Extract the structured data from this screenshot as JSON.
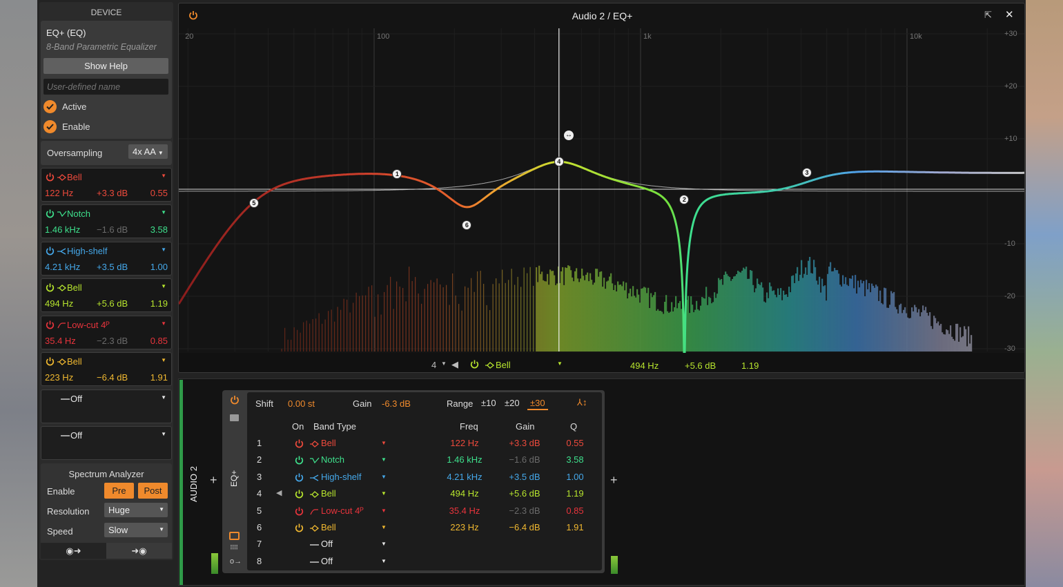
{
  "window": {
    "title": "Audio 2 / EQ+"
  },
  "device_panel": {
    "header": "DEVICE",
    "name": "EQ+ (EQ)",
    "description": "8-Band Parametric Equalizer",
    "show_help": "Show Help",
    "user_name_placeholder": "User-defined name",
    "active_label": "Active",
    "active": true,
    "enable_label": "Enable",
    "enable": true,
    "oversampling_label": "Oversampling",
    "oversampling_value": "4x AA",
    "off_label": "Off",
    "spectrum": {
      "title": "Spectrum Analyzer",
      "enable_label": "Enable",
      "pre": "Pre",
      "post": "Post",
      "resolution_label": "Resolution",
      "resolution": "Huge",
      "speed_label": "Speed",
      "speed": "Slow"
    }
  },
  "bands": [
    {
      "num": "1",
      "type": "Bell",
      "icon": "bell",
      "freq": "122 Hz",
      "gain": "+3.3 dB",
      "q": "0.55",
      "freq_hz": 122,
      "gain_db": 3.3,
      "q_val": 0.55,
      "color": "#ee4a3c",
      "gain_dim": false
    },
    {
      "num": "2",
      "type": "Notch",
      "icon": "notch",
      "freq": "1.46 kHz",
      "gain": "−1.6 dB",
      "q": "3.58",
      "freq_hz": 1460,
      "gain_db": -1.6,
      "q_val": 3.58,
      "color": "#3ee08c",
      "gain_dim": true
    },
    {
      "num": "3",
      "type": "High-shelf",
      "icon": "high-shelf",
      "freq": "4.21 kHz",
      "gain": "+3.5 dB",
      "q": "1.00",
      "freq_hz": 4210,
      "gain_db": 3.5,
      "q_val": 1.0,
      "color": "#45a8ea",
      "gain_dim": false
    },
    {
      "num": "4",
      "type": "Bell",
      "icon": "bell",
      "freq": "494 Hz",
      "gain": "+5.6 dB",
      "q": "1.19",
      "freq_hz": 494,
      "gain_db": 5.6,
      "q_val": 1.19,
      "color": "#b8e62e",
      "gain_dim": false
    },
    {
      "num": "5",
      "type": "Low-cut 4ᴾ",
      "icon": "low-cut",
      "freq": "35.4 Hz",
      "gain": "−2.3 dB",
      "q": "0.85",
      "freq_hz": 35.4,
      "gain_db": -2.3,
      "q_val": 0.85,
      "color": "#e8343c",
      "gain_dim": true
    },
    {
      "num": "6",
      "type": "Bell",
      "icon": "bell",
      "freq": "223 Hz",
      "gain": "−6.4 dB",
      "q": "1.91",
      "freq_hz": 223,
      "gain_db": -6.4,
      "q_val": 1.91,
      "color": "#f0b830",
      "gain_dim": false
    },
    {
      "num": "7",
      "type": "Off",
      "icon": "off",
      "color": "#e8e8e8"
    },
    {
      "num": "8",
      "type": "Off",
      "icon": "off",
      "color": "#e8e8e8"
    }
  ],
  "graph": {
    "freq_ticks": [
      "20",
      "100",
      "1k",
      "10k"
    ],
    "freq_tick_values": [
      20,
      100,
      1000,
      10000
    ],
    "db_ticks": [
      "+30",
      "+20",
      "+10",
      "-10",
      "-20",
      "-30"
    ],
    "db_tick_values": [
      30,
      20,
      10,
      -10,
      -20,
      -30
    ],
    "selected_band": "4",
    "selected": {
      "num": "4",
      "type": "Bell",
      "freq": "494 Hz",
      "gain": "+5.6 dB",
      "q": "1.19"
    }
  },
  "bottom": {
    "track": "AUDIO 2",
    "device_tab": "EQ+",
    "shift_label": "Shift",
    "shift_value": "0.00 st",
    "gain_label": "Gain",
    "gain_value": "-6.3 dB",
    "range_label": "Range",
    "ranges": [
      "±10",
      "±20",
      "±30"
    ],
    "range_selected": "±30",
    "cols": {
      "on": "On",
      "type": "Band Type",
      "freq": "Freq",
      "gain": "Gain",
      "q": "Q"
    },
    "add": "+"
  },
  "colors": {
    "accent": "#f08a2c",
    "dim": "#6a6a6a"
  }
}
